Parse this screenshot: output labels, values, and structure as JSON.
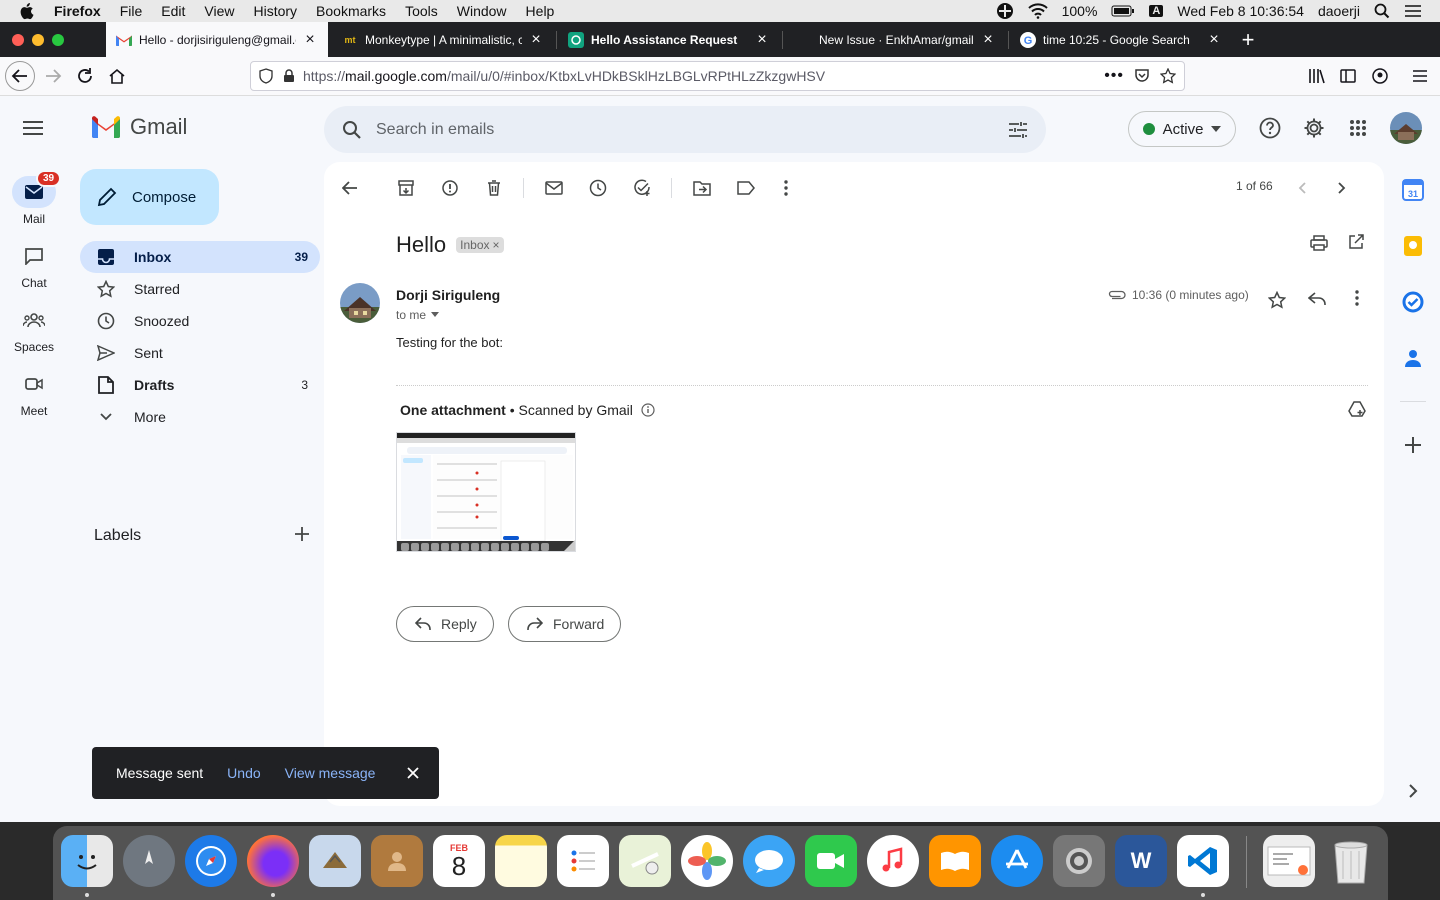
{
  "menubar": {
    "app_name": "Firefox",
    "menus": [
      "File",
      "Edit",
      "View",
      "History",
      "Bookmarks",
      "Tools",
      "Window",
      "Help"
    ],
    "battery": "100%",
    "input_source": "A",
    "datetime": "Wed Feb 8  10:36:54",
    "user": "daoerji"
  },
  "tabs": [
    {
      "title": "Hello - dorjisiriguleng@gmail.co",
      "favicon": "gmail-icon",
      "active": true
    },
    {
      "title": "Monkeytype | A minimalistic, cu",
      "favicon": "monkeytype-icon",
      "fav_text": "mt"
    },
    {
      "title": "Hello Assistance Request",
      "favicon": "openai-icon"
    },
    {
      "title": "New Issue · EnkhAmar/gmail-bo",
      "favicon": "github-icon"
    },
    {
      "title": "time 10:25 - Google Search",
      "favicon": "google-icon"
    }
  ],
  "url": {
    "scheme": "https://",
    "host": "mail.google.com",
    "path": "/mail/u/0/#inbox/KtbxLvHDkBSklHzLBGLvRPtHLzZkzgwHSV"
  },
  "rail": {
    "items": [
      {
        "label": "Mail",
        "icon": "mail-icon",
        "badge": "39"
      },
      {
        "label": "Chat",
        "icon": "chat-icon"
      },
      {
        "label": "Spaces",
        "icon": "spaces-icon"
      },
      {
        "label": "Meet",
        "icon": "meet-icon"
      }
    ]
  },
  "header": {
    "logo_text": "Gmail",
    "search_placeholder": "Search in emails",
    "status_label": "Active"
  },
  "nav": {
    "compose_label": "Compose",
    "items": [
      {
        "label": "Inbox",
        "count": "39",
        "icon": "inbox-icon"
      },
      {
        "label": "Starred",
        "count": "",
        "icon": "star-icon"
      },
      {
        "label": "Snoozed",
        "count": "",
        "icon": "clock-icon"
      },
      {
        "label": "Sent",
        "count": "",
        "icon": "send-icon"
      },
      {
        "label": "Drafts",
        "count": "3",
        "icon": "draft-icon"
      },
      {
        "label": "More",
        "count": "",
        "icon": "chevron-down-icon"
      }
    ],
    "labels_heading": "Labels"
  },
  "message": {
    "pager": "1 of 66",
    "subject": "Hello",
    "label_chip": "Inbox",
    "sender": "Dorji Siriguleng",
    "recipient": "to me",
    "time": "10:36 (0 minutes ago)",
    "body": "Testing for the bot:",
    "attachment_title": "One attachment",
    "attachment_scan": " • Scanned by Gmail",
    "reply_label": "Reply",
    "forward_label": "Forward"
  },
  "toast": {
    "message": "Message sent",
    "undo": "Undo",
    "view": "View message"
  },
  "calendar_day": "31",
  "dock": {
    "calendar_month": "FEB",
    "calendar_day": "8",
    "word_letter": "W"
  },
  "colors": {
    "accent_blue": "#0b57d0",
    "nav_active_bg": "#d3e3fd",
    "compose_bg": "#c2e7ff",
    "badge_red": "#d93025",
    "status_green": "#1e8e3e"
  }
}
